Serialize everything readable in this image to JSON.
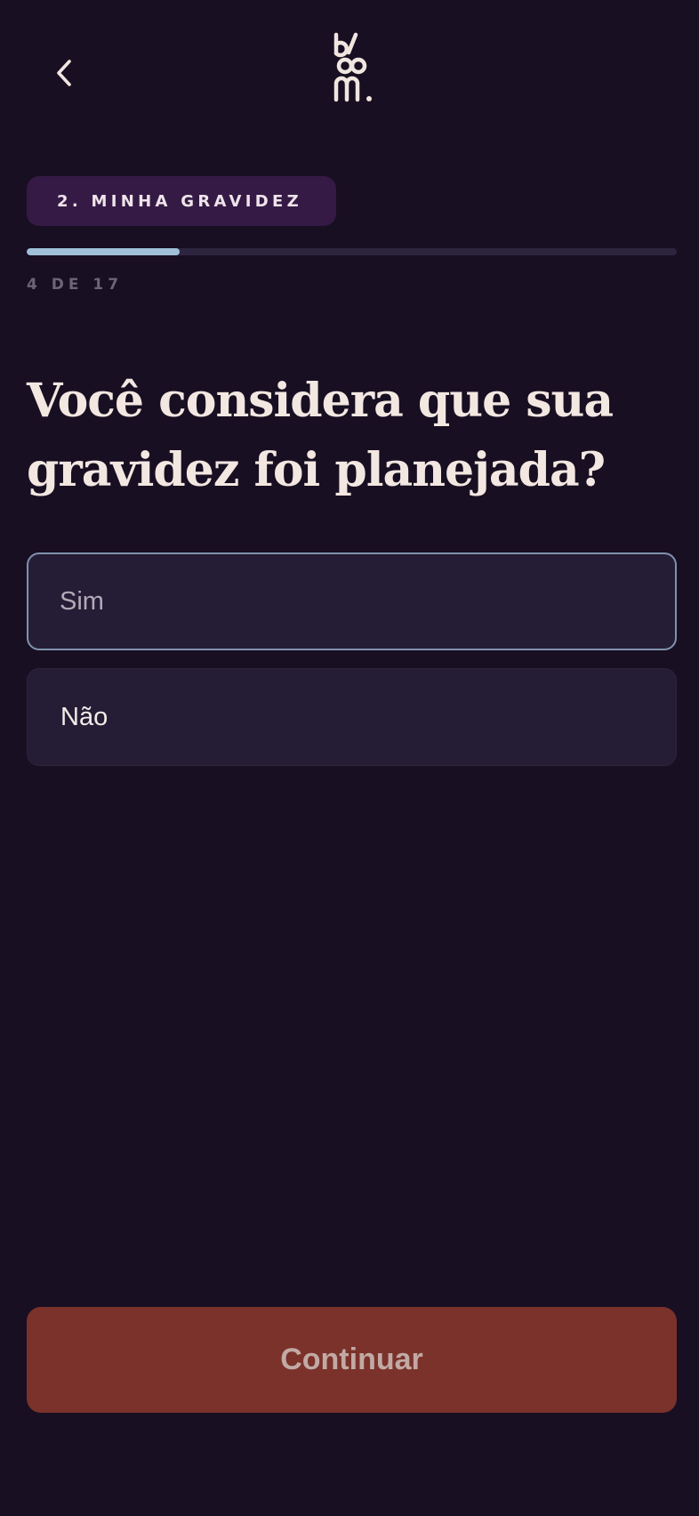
{
  "header": {
    "back_icon": "chevron-left-icon",
    "logo_text": "bloom."
  },
  "progress": {
    "section_label": "2. MINHA GRAVIDEZ",
    "step_text": "4 DE 17",
    "current_step": 4,
    "total_steps": 17,
    "fill_fraction": 0.235
  },
  "question": {
    "title": "Você considera que sua gravidez foi planejada?"
  },
  "options": [
    {
      "label": "Sim",
      "focused": true
    },
    {
      "label": "Não",
      "focused": false
    }
  ],
  "footer": {
    "continue_label": "Continuar"
  },
  "colors": {
    "background": "#180f22",
    "badge": "#351a45",
    "progress_fill": "#9fc0d8",
    "progress_track": "#2d2540",
    "option_bg": "#251d35",
    "option_focus_border": "#7f92ad",
    "continue_button": "#7a322b"
  }
}
